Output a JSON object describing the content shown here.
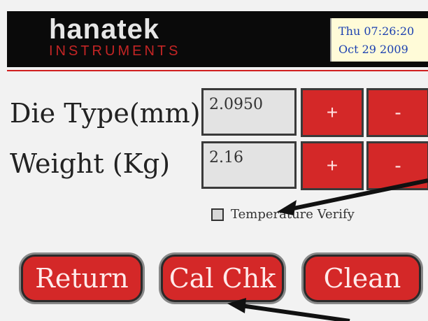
{
  "header": {
    "logo_top": "hanatek",
    "logo_bottom": "INSTRUMENTS",
    "clock_line1": "Thu 07:26:20",
    "clock_line2": "Oct 29  2009"
  },
  "die_type": {
    "label": "Die Type(mm)",
    "value": "2.0950",
    "plus": "+",
    "minus": "-"
  },
  "weight": {
    "label": "Weight (Kg)",
    "value": "2.16",
    "plus": "+",
    "minus": "-"
  },
  "temperature_verify": {
    "label": "Temperature Verify",
    "checked": false
  },
  "buttons": {
    "return": "Return",
    "cal_chk": "Cal Chk",
    "clean": "Clean"
  },
  "colors": {
    "accent": "#d42828",
    "header_bg": "#0a0a0a",
    "clock_text": "#1a3fb0"
  }
}
